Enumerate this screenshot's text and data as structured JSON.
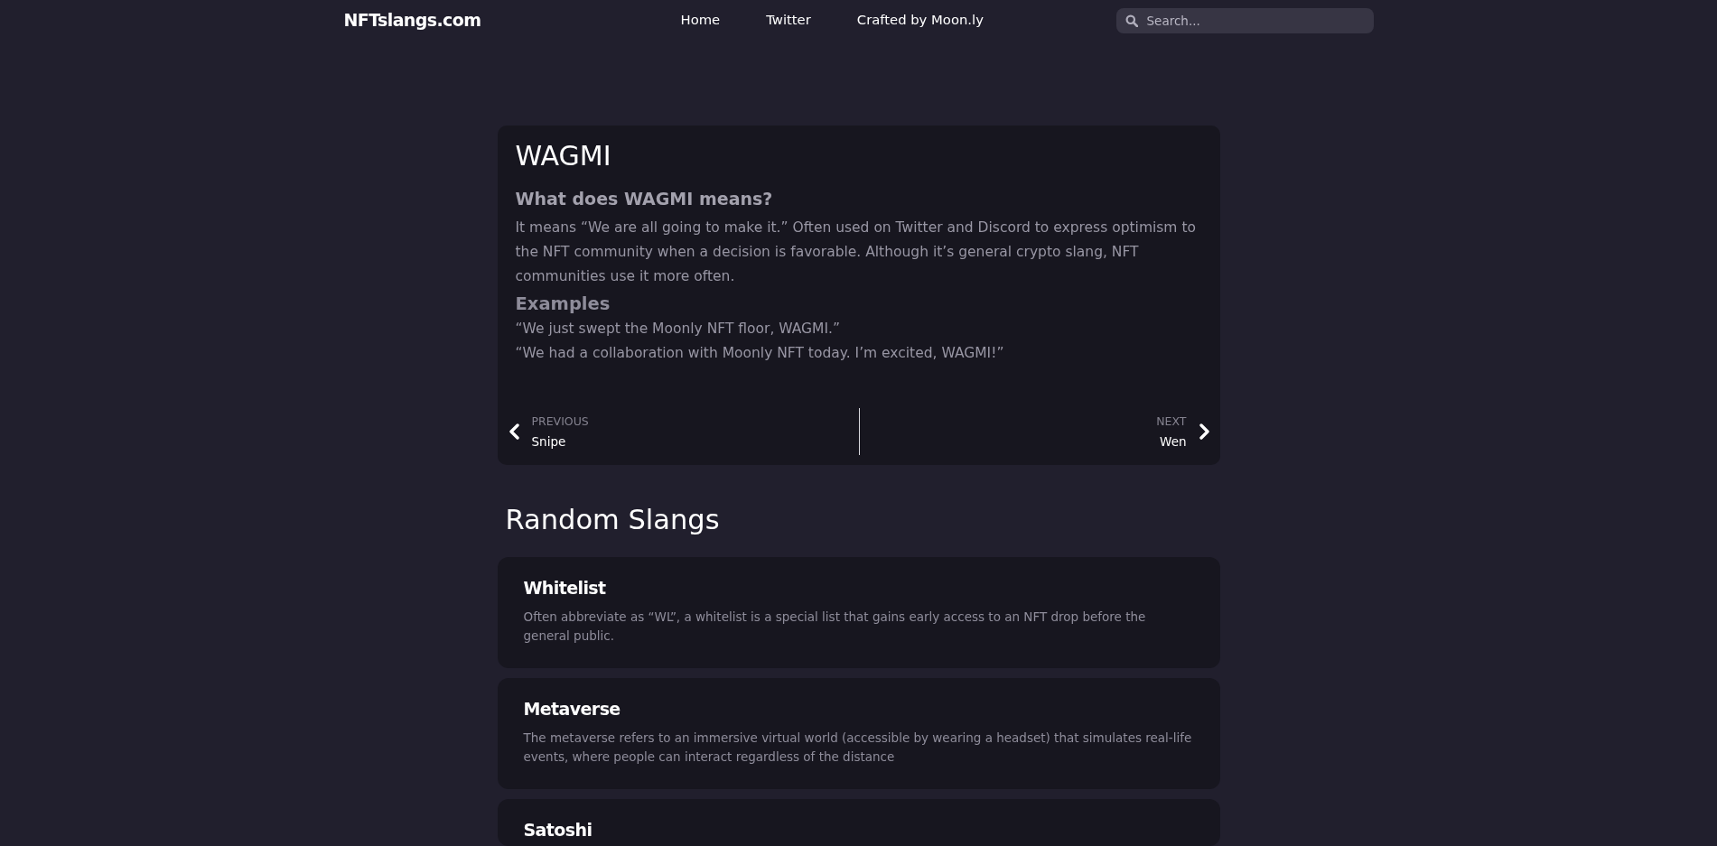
{
  "header": {
    "logo": "NFTslangs.com",
    "nav": [
      "Home",
      "Twitter",
      "Crafted by Moon.ly"
    ],
    "search": {
      "placeholder": "Search..."
    }
  },
  "entry": {
    "title": "WAGMI",
    "question": "What does WAGMI means?",
    "answer": "It means “We are all going to make it.” Often used on Twitter and Discord to express optimism to the NFT community when a decision is favorable. Although it’s general crypto slang, NFT communities use it more often.",
    "examples_heading": "Examples",
    "examples": [
      "“We just swept the Moonly NFT floor, WAGMI.”",
      "“We had a collaboration with Moonly NFT today. I’m excited, WAGMI!”"
    ],
    "pager": {
      "previous": {
        "label": "PREVIOUS",
        "term": "Snipe"
      },
      "next": {
        "label": "NEXT",
        "term": "Wen"
      }
    }
  },
  "random": {
    "heading": "Random Slangs",
    "items": [
      {
        "title": "Whitelist",
        "text": "Often abbreviate as “WL”, a whitelist is a special list that gains early access to an NFT drop before the general public."
      },
      {
        "title": "Metaverse",
        "text": "The metaverse refers to an immersive virtual world (accessible by wearing a headset) that simulates real-life events, where people can interact regardless of the distance"
      },
      {
        "title": "Satoshi"
      }
    ]
  }
}
